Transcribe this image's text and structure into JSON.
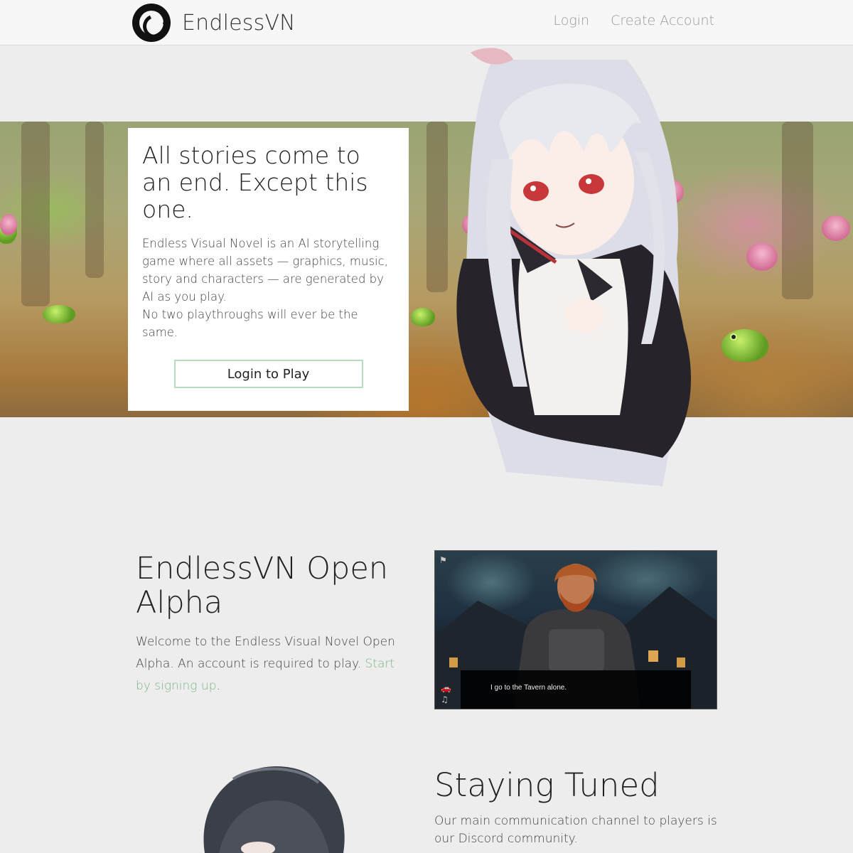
{
  "navbar": {
    "brand": "EndlessVN",
    "links": [
      "Login",
      "Create Account"
    ]
  },
  "hero": {
    "title": "All stories come to an end. Except this one.",
    "description_1": "Endless Visual Novel is an AI storytelling game where all assets — graphics, music, story and characters — are generated by AI as you play.",
    "description_2": "No two playthroughs will ever be the same.",
    "button": "Login to Play"
  },
  "alpha": {
    "title": "EndlessVN Open Alpha",
    "text_before": "Welcome to the Endless Visual Novel Open Alpha. An account is required to play. ",
    "link": "Start by signing up",
    "text_after": ".",
    "screenshot": {
      "dialog": "I go to the Tavern alone."
    }
  },
  "tuned": {
    "title": "Staying Tuned",
    "text": "Our main communication channel to players is our Discord community."
  },
  "colors": {
    "accent": "#7fb58a",
    "button_border": "#b9d9be",
    "background": "#ededed"
  },
  "icons": [
    "logo-icon",
    "flag-icon",
    "car-icon",
    "mute-music-icon"
  ]
}
